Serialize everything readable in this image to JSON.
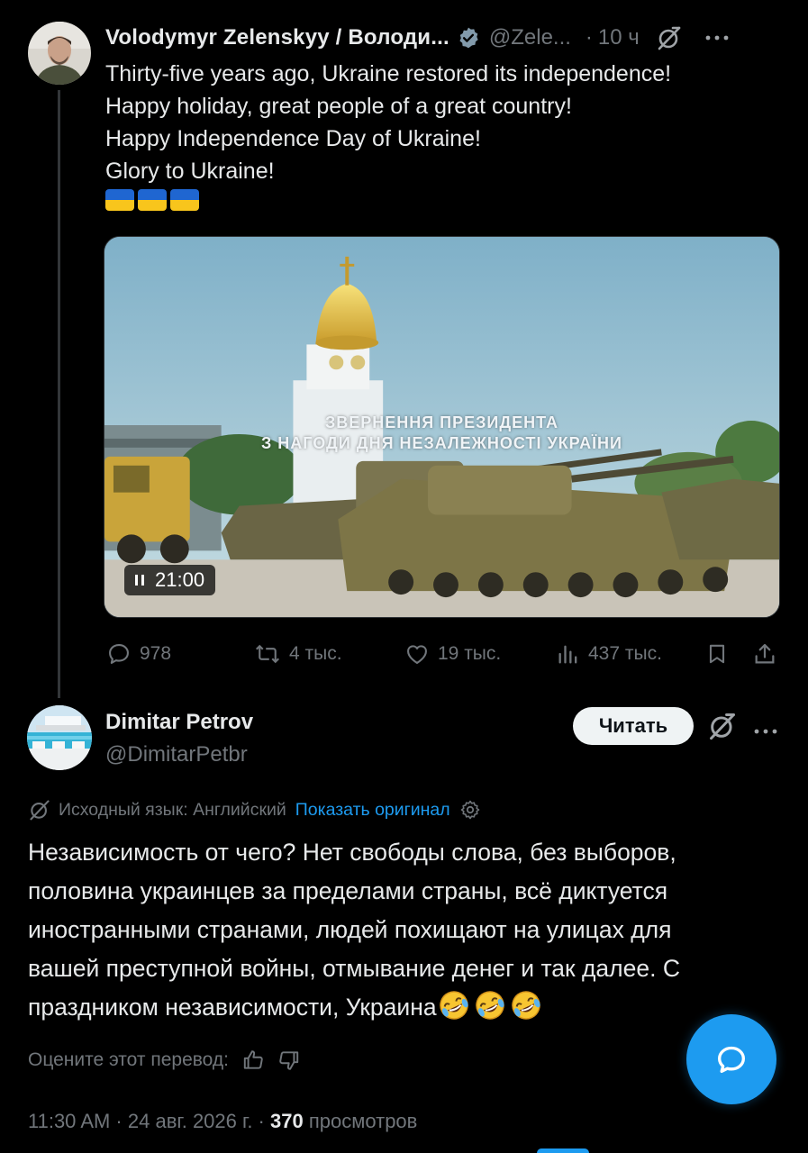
{
  "original_tweet": {
    "author_name": "Volodymyr Zelenskyy / Володи...",
    "handle": "@Zele...",
    "separator": "·",
    "time": "10 ч",
    "text_lines": [
      "Thirty-five years ago, Ukraine restored its independence!",
      "Happy holiday, great people of a great country!",
      "Happy Independence Day of Ukraine!",
      "Glory to Ukraine!"
    ],
    "flag_emoji_count": 3,
    "video": {
      "overlay_line1": "ЗВЕРНЕННЯ ПРЕЗИДЕНТА",
      "overlay_line2": "З НАГОДИ ДНЯ НЕЗАЛЕЖНОСТІ УКРАЇНИ",
      "duration": "21:00",
      "state": "playing"
    },
    "actions": {
      "replies": "978",
      "reposts": "4 тыс.",
      "likes": "19 тыс.",
      "views": "437 тыс."
    }
  },
  "reply": {
    "author_name": "Dimitar Petrov",
    "handle": "@DimitarPetbr",
    "follow_label": "Читать",
    "translation_note": "Исходный язык: Английский",
    "show_original_label": "Показать оригинал",
    "text_lines": [
      "Независимость от чего? Нет свободы слова, без выборов,",
      "половина украинцев за пределами страны, всё диктуется",
      "иностранными странами, людей похищают на улицах для",
      "вашей преступной войны, отмывание денег и так далее. С",
      "праздником независимости, Украина"
    ],
    "emoji": "🤣🤣🤣",
    "rate_label": "Оцените этот перевод:",
    "timestamp": "11:30 AM · 24 авг. 2026 г. ·",
    "views_count": "370",
    "views_label": "просмотров"
  },
  "colors": {
    "background": "#000000",
    "text_primary": "#e7e9ea",
    "text_secondary": "#71767b",
    "accent": "#1d9bf0",
    "verified_badge": "#829aab"
  }
}
